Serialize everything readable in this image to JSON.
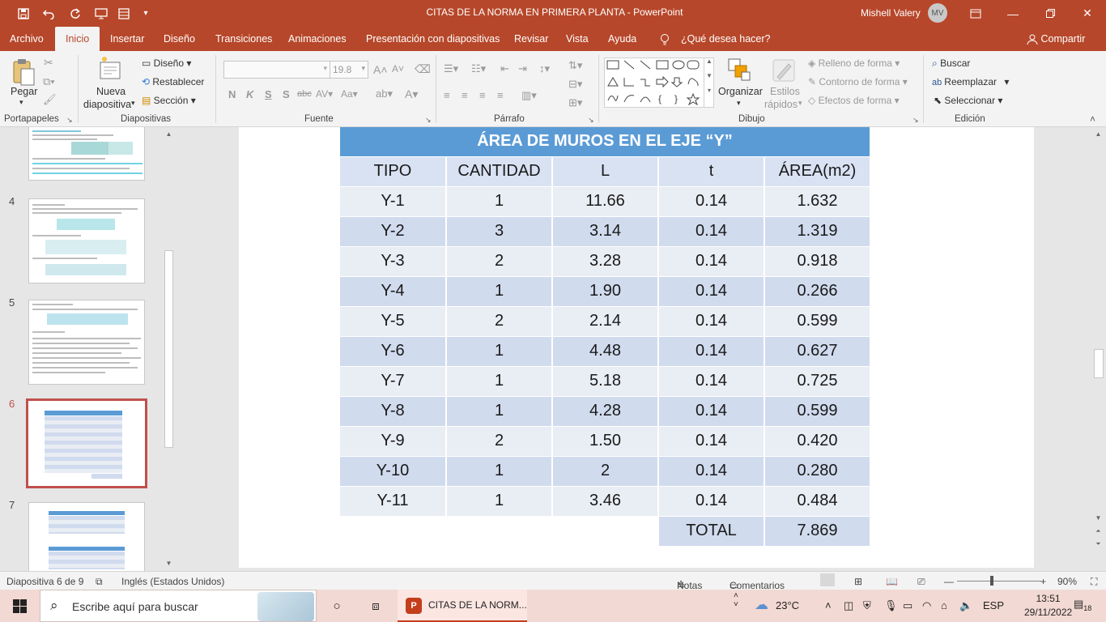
{
  "titlebar": {
    "title": "CITAS DE LA NORMA EN PRIMERA PLANTA  -  PowerPoint",
    "user": "Mishell Valery",
    "avatar_initials": "MV",
    "quick_access": [
      "save-icon",
      "undo-icon",
      "redo-icon",
      "present-icon",
      "customize-icon"
    ]
  },
  "menu": {
    "tabs": [
      "Archivo",
      "Inicio",
      "Insertar",
      "Diseño",
      "Transiciones",
      "Animaciones",
      "Presentación con diapositivas",
      "Revisar",
      "Vista",
      "Ayuda"
    ],
    "active": "Inicio",
    "tell_me": "¿Qué desea hacer?",
    "share": "Compartir"
  },
  "ribbon": {
    "clipboard": {
      "label": "Portapapeles",
      "paste": "Pegar"
    },
    "slides": {
      "label": "Diapositivas",
      "new_slide_1": "Nueva",
      "new_slide_2": "diapositiva",
      "layout": "Diseño",
      "reset": "Restablecer",
      "section": "Sección"
    },
    "font": {
      "label": "Fuente",
      "font_size": "19.8",
      "bold": "N",
      "italic": "K",
      "underline": "S",
      "shadow": "S",
      "strike": "abc"
    },
    "paragraph": {
      "label": "Párrafo"
    },
    "drawing": {
      "label": "Dibujo",
      "arrange": "Organizar",
      "styles_1": "Estilos",
      "styles_2": "rápidos",
      "fill": "Relleno de forma",
      "outline": "Contorno de forma",
      "effects": "Efectos de forma"
    },
    "editing": {
      "label": "Edición",
      "find": "Buscar",
      "replace": "Reemplazar",
      "select": "Seleccionar"
    }
  },
  "thumbnails": [
    {
      "num": "4"
    },
    {
      "num": "5"
    },
    {
      "num": "6",
      "selected": true
    },
    {
      "num": "7"
    }
  ],
  "slide": {
    "table_title": "ÁREA DE MUROS EN EL EJE “Y”",
    "headers": [
      "TIPO",
      "CANTIDAD",
      "L",
      "t",
      "ÁREA(m2)"
    ],
    "rows": [
      [
        "Y-1",
        "1",
        "11.66",
        "0.14",
        "1.632"
      ],
      [
        "Y-2",
        "3",
        "3.14",
        "0.14",
        "1.319"
      ],
      [
        "Y-3",
        "2",
        "3.28",
        "0.14",
        "0.918"
      ],
      [
        "Y-4",
        "1",
        "1.90",
        "0.14",
        "0.266"
      ],
      [
        "Y-5",
        "2",
        "2.14",
        "0.14",
        "0.599"
      ],
      [
        "Y-6",
        "1",
        "4.48",
        "0.14",
        "0.627"
      ],
      [
        "Y-7",
        "1",
        "5.18",
        "0.14",
        "0.725"
      ],
      [
        "Y-8",
        "1",
        "4.28",
        "0.14",
        "0.599"
      ],
      [
        "Y-9",
        "2",
        "1.50",
        "0.14",
        "0.420"
      ],
      [
        "Y-10",
        "1",
        "2",
        "0.14",
        "0.280"
      ],
      [
        "Y-11",
        "1",
        "3.46",
        "0.14",
        "0.484"
      ]
    ],
    "total_label": "TOTAL",
    "total_value": "7.869"
  },
  "status": {
    "slide_info": "Diapositiva 6 de 9",
    "language": "Inglés (Estados Unidos)",
    "notes": "Notas",
    "comments": "Comentarios",
    "zoom": "90%"
  },
  "taskbar": {
    "search_placeholder": "Escribe aquí para buscar",
    "app_label": "CITAS DE LA NORM...",
    "weather": "23°C",
    "lang": "ESP",
    "time": "13:51",
    "date": "29/11/2022",
    "notif_count": "18"
  },
  "colors": {
    "accent": "#b7472a",
    "table_header": "#5b9bd5",
    "row_light": "#e9edf4",
    "row_dark": "#d0dbee",
    "selected_thumb": "#c0504d"
  }
}
